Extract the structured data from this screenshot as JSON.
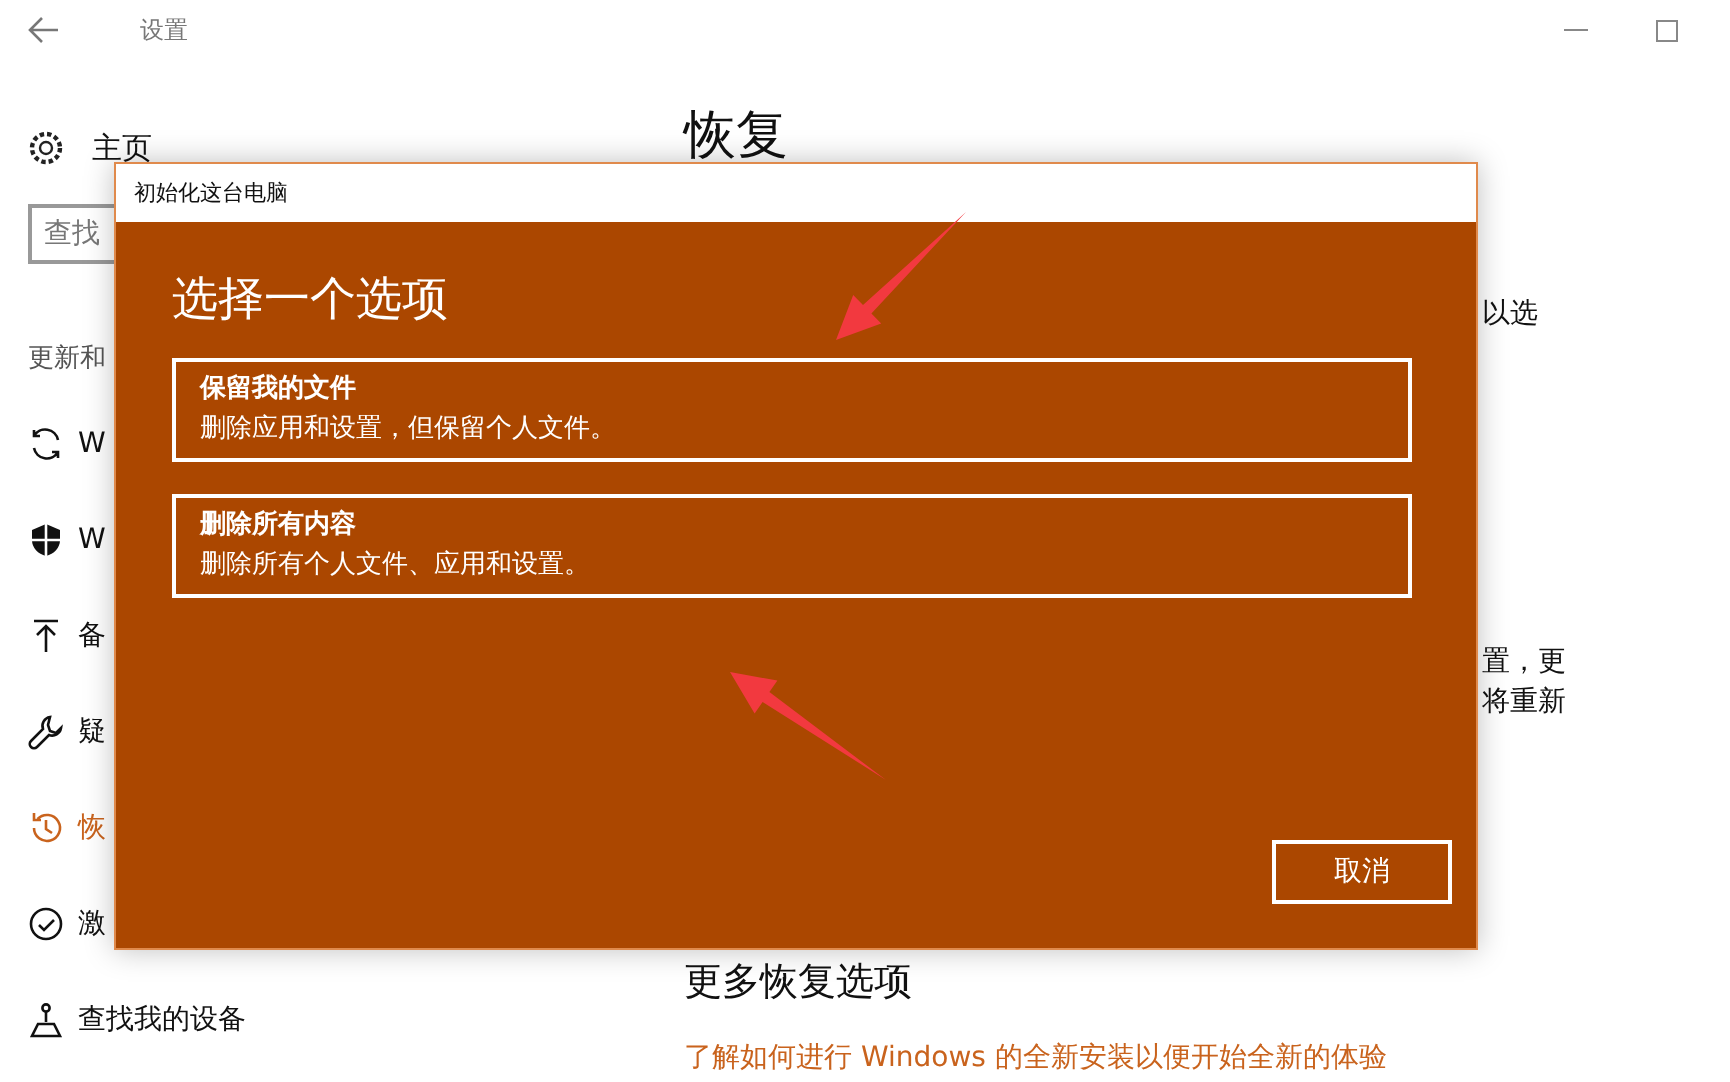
{
  "window": {
    "title": "设置"
  },
  "sidebar": {
    "home": "主页",
    "search": {
      "placeholder": "查找"
    },
    "section_title": "更新和",
    "items": [
      {
        "label": "W",
        "selected": false
      },
      {
        "label": "W",
        "selected": false
      },
      {
        "label": "备",
        "selected": false
      },
      {
        "label": "疑",
        "selected": false
      },
      {
        "label": "恢",
        "selected": true
      },
      {
        "label": "激",
        "selected": false
      },
      {
        "label": "查找我的设备",
        "selected": false
      }
    ]
  },
  "main": {
    "title": "恢复",
    "fragments": [
      "以选",
      "置，更",
      "将重新"
    ],
    "more_title": "更多恢复选项",
    "link": "了解如何进行 Windows 的全新安装以便开始全新的体验"
  },
  "dialog": {
    "title": "初始化这台电脑",
    "heading": "选择一个选项",
    "options": [
      {
        "title": "保留我的文件",
        "description": "删除应用和设置，但保留个人文件。"
      },
      {
        "title": "删除所有内容",
        "description": "删除所有个人文件、应用和设置。"
      }
    ],
    "cancel": "取消"
  }
}
